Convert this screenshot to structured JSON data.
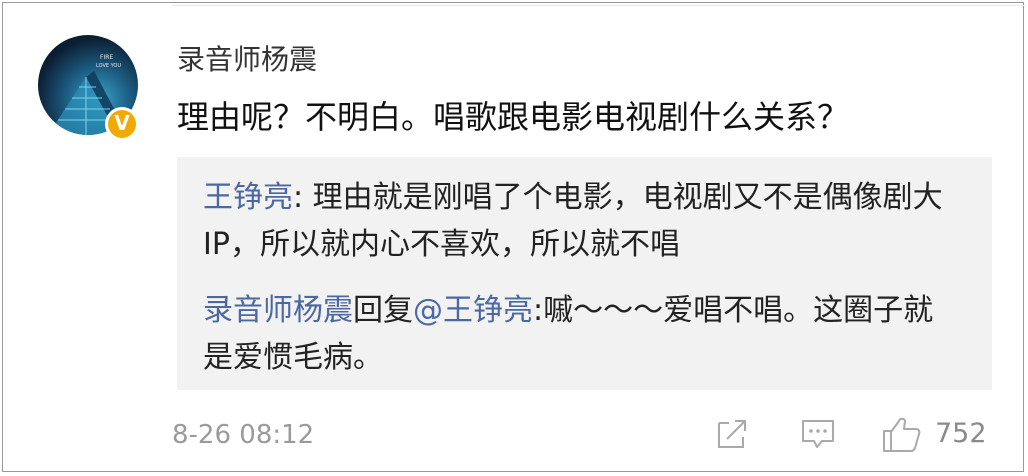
{
  "comment": {
    "author": "录音师杨震",
    "text": "理由呢？不明白。唱歌跟电影电视剧什么关系？",
    "avatar_badge": "V",
    "avatar_caption_lines": [
      "FIRE",
      "LOVE YOU"
    ],
    "timestamp": "8-26 08:12",
    "like_count": "752"
  },
  "replies": [
    {
      "author": "王铮亮",
      "separator": ": ",
      "text": "理由就是刚唱了个电影，电视剧又不是偶像剧大IP，所以就内心不喜欢，所以就不唱"
    },
    {
      "author": "录音师杨震",
      "reply_word": "回复",
      "mention": "@王铮亮",
      "separator": ":",
      "text": "嘁～～～爱唱不唱。这圈子就是爱惯毛病。"
    }
  ],
  "icons": {
    "share": "share-icon",
    "comment": "comment-icon",
    "like": "thumbs-up-icon",
    "verified": "verified-badge-icon"
  },
  "colors": {
    "link": "#4b68a1",
    "badge": "#f2a900",
    "reply_background": "#f2f2f2",
    "meta_text": "#9a9a9a"
  }
}
